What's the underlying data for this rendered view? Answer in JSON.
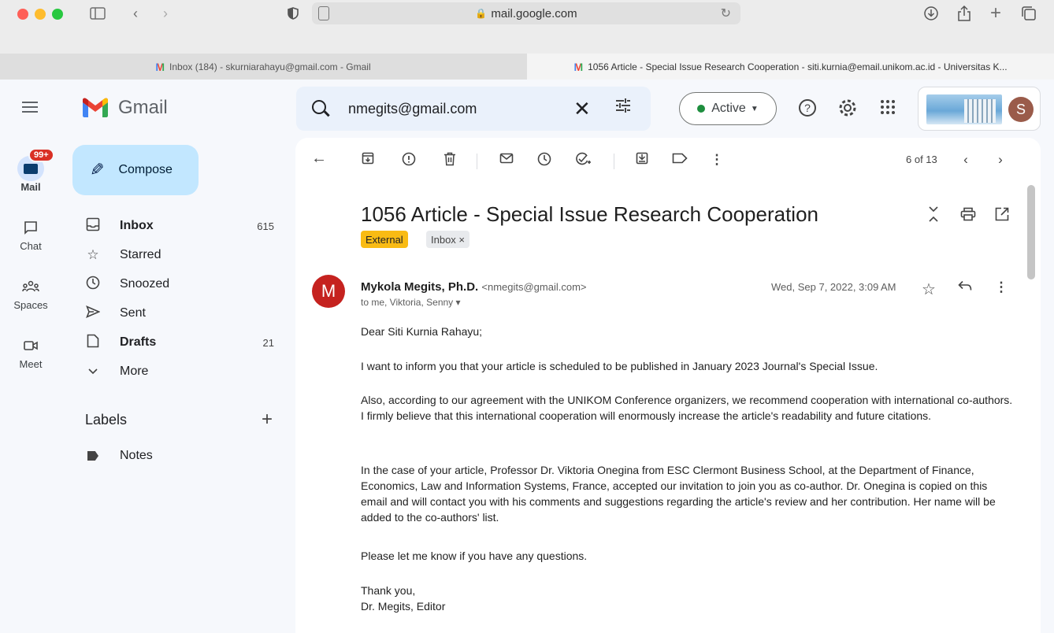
{
  "browser": {
    "address": "mail.google.com",
    "tabs": [
      {
        "title": "Inbox (184) - skurniarahayu@gmail.com - Gmail",
        "active": false
      },
      {
        "title": "1056 Article - Special Issue Research Cooperation - siti.kurnia@email.unikom.ac.id - Universitas K...",
        "active": true
      }
    ]
  },
  "header": {
    "app_name": "Gmail",
    "search_value": "nmegits@gmail.com",
    "status_label": "Active",
    "profile_initial": "S"
  },
  "rail": [
    {
      "label": "Mail",
      "badge": "99+"
    },
    {
      "label": "Chat"
    },
    {
      "label": "Spaces"
    },
    {
      "label": "Meet"
    }
  ],
  "nav": {
    "compose": "Compose",
    "items": [
      {
        "label": "Inbox",
        "count": "615",
        "icon": "inbox-icon"
      },
      {
        "label": "Starred",
        "count": "",
        "icon": "star-icon"
      },
      {
        "label": "Snoozed",
        "count": "",
        "icon": "clock-icon"
      },
      {
        "label": "Sent",
        "count": "",
        "icon": "send-icon"
      },
      {
        "label": "Drafts",
        "count": "21",
        "icon": "draft-icon"
      },
      {
        "label": "More",
        "count": "",
        "icon": "chevron-down-icon"
      }
    ],
    "labels_heading": "Labels",
    "labels": [
      {
        "label": "Notes"
      }
    ]
  },
  "message": {
    "pager": "6 of 13",
    "subject": "1056 Article - Special Issue Research Cooperation",
    "chips": [
      "External",
      "Inbox ×"
    ],
    "avatar_initial": "M",
    "sender_name": "Mykola Megits, Ph.D.",
    "sender_email": "<nmegits@gmail.com>",
    "recipients": "to me, Viktoria, Senny ▾",
    "date": "Wed, Sep 7, 2022, 3:09 AM",
    "body": [
      "Dear Siti Kurnia Rahayu;",
      "I want to inform you that your article is scheduled to be published in January 2023 Journal's Special Issue.",
      "Also, according to our agreement with the UNIKOM Conference organizers, we recommend cooperation with international co-authors. I firmly believe that this international cooperation will enormously increase the article's readability and future citations.",
      "In the case of your article, Professor Dr. Viktoria Onegina from ESC Clermont Business School, at the Department of Finance, Economics, Law and Information Systems, France, accepted our invitation to join you as co-author. Dr. Onegina is copied on this email and will contact you with his comments and suggestions regarding the article's review and her contribution. Her name will be added to the co-authors' list.",
      "Please let me know if you have any questions.",
      "Thank you,",
      "Dr. Megits, Editor"
    ]
  },
  "colors": {
    "compose_bg": "#c2e7ff",
    "external_chip": "#f9bb14",
    "avatar_m": "#c5221f",
    "active_dot": "#1e8e3e",
    "badge": "#d93025"
  }
}
